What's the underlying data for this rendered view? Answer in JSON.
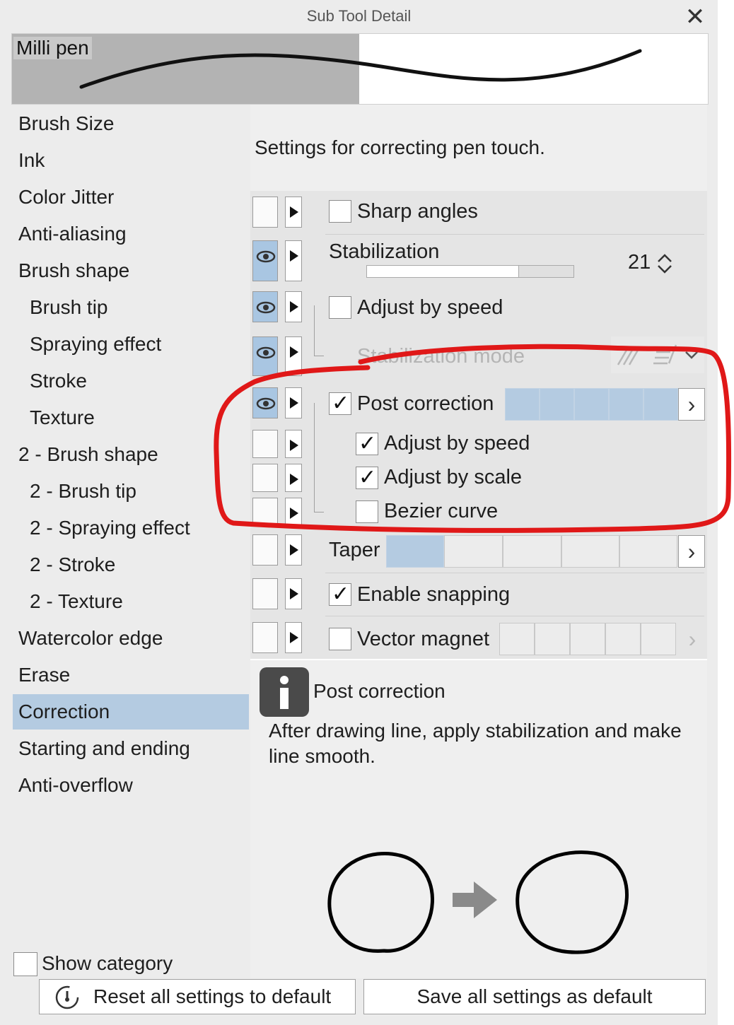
{
  "window": {
    "title": "Sub Tool Detail",
    "close_icon": "close-icon"
  },
  "preview": {
    "tool_name": "Milli pen"
  },
  "sidebar": {
    "items": [
      {
        "label": "Brush Size",
        "sub": false,
        "selected": false
      },
      {
        "label": "Ink",
        "sub": false,
        "selected": false
      },
      {
        "label": "Color Jitter",
        "sub": false,
        "selected": false
      },
      {
        "label": "Anti-aliasing",
        "sub": false,
        "selected": false
      },
      {
        "label": "Brush shape",
        "sub": false,
        "selected": false
      },
      {
        "label": "Brush tip",
        "sub": true,
        "selected": false
      },
      {
        "label": "Spraying effect",
        "sub": true,
        "selected": false
      },
      {
        "label": "Stroke",
        "sub": true,
        "selected": false
      },
      {
        "label": "Texture",
        "sub": true,
        "selected": false
      },
      {
        "label": "2 - Brush shape",
        "sub": false,
        "selected": false
      },
      {
        "label": "2 - Brush tip",
        "sub": true,
        "selected": false
      },
      {
        "label": "2 - Spraying effect",
        "sub": true,
        "selected": false
      },
      {
        "label": "2 - Stroke",
        "sub": true,
        "selected": false
      },
      {
        "label": "2 - Texture",
        "sub": true,
        "selected": false
      },
      {
        "label": "Watercolor edge",
        "sub": false,
        "selected": false
      },
      {
        "label": "Erase",
        "sub": false,
        "selected": false
      },
      {
        "label": "Correction",
        "sub": false,
        "selected": true
      },
      {
        "label": "Starting and ending",
        "sub": false,
        "selected": false
      },
      {
        "label": "Anti-overflow",
        "sub": false,
        "selected": false
      }
    ],
    "show_category": {
      "label": "Show category",
      "checked": false
    }
  },
  "settings": {
    "description": "Settings for correcting pen touch.",
    "sharp_angles": {
      "label": "Sharp angles",
      "checked": false
    },
    "stabilization": {
      "label": "Stabilization",
      "value": "21"
    },
    "adjust_by_speed": {
      "label": "Adjust by speed",
      "checked": false
    },
    "stabilization_mode": {
      "label": "Stabilization mode"
    },
    "post_correction": {
      "label": "Post correction",
      "checked": true,
      "level": 5,
      "max": 5
    },
    "post_adjust_by_speed": {
      "label": "Adjust by speed",
      "checked": true
    },
    "post_adjust_by_scale": {
      "label": "Adjust by scale",
      "checked": true
    },
    "bezier_curve": {
      "label": "Bezier curve",
      "checked": false
    },
    "taper": {
      "label": "Taper",
      "level": 1,
      "max": 5
    },
    "enable_snapping": {
      "label": "Enable snapping",
      "checked": true
    },
    "vector_magnet": {
      "label": "Vector magnet",
      "checked": false,
      "level": 0,
      "max": 5
    }
  },
  "help": {
    "title": "Post correction",
    "text": "After drawing line, apply stabilization and make line smooth."
  },
  "footer": {
    "reset_label": "Reset all settings to default",
    "save_label": "Save all settings as default"
  },
  "colors": {
    "selected": "#b4cbe1",
    "annotation": "#e01818"
  }
}
